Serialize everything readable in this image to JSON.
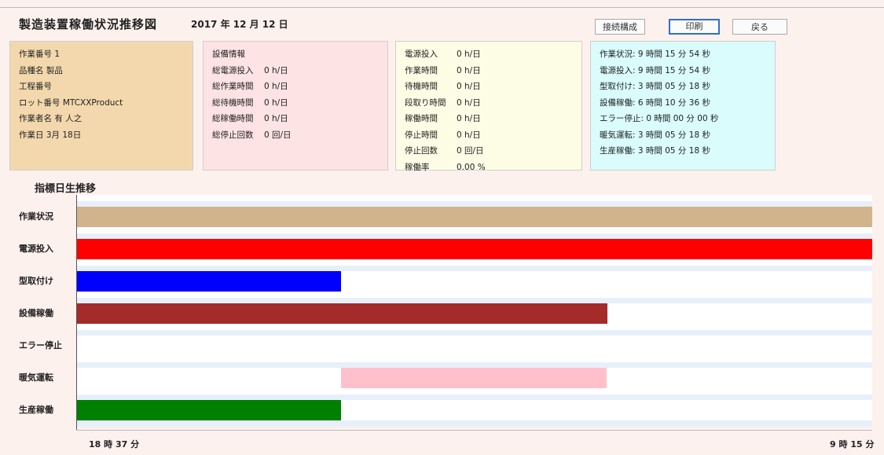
{
  "header": {
    "title": "製造装置稼働状況推移図",
    "date": "2017 年 12 月 12 日"
  },
  "toolbar": {
    "connection_label": "接続構成",
    "print_label": "印刷",
    "back_label": "戻る"
  },
  "work_panel": {
    "rows": [
      "作業番号 1",
      "品種名 製品",
      "工程番号",
      "ロット番号 MTCXXProduct",
      "作業者名 有 人之",
      "作業日 3月 18日"
    ]
  },
  "equipment_panel": {
    "rows": [
      {
        "key": "設備情報",
        "value": ""
      },
      {
        "key": "総電源投入",
        "value": "0 h/日"
      },
      {
        "key": "総作業時間",
        "value": "0 h/日"
      },
      {
        "key": "総待機時間",
        "value": "0 h/日"
      },
      {
        "key": "総稼働時間",
        "value": "0 h/日"
      },
      {
        "key": "総停止回数",
        "value": "0 回/日"
      }
    ]
  },
  "time_panel": {
    "rows": [
      {
        "key": "電源投入",
        "value": "0 h/日"
      },
      {
        "key": "作業時間",
        "value": "0 h/日"
      },
      {
        "key": "待機時間",
        "value": "0 h/日"
      },
      {
        "key": "段取り時間",
        "value": "0 h/日"
      },
      {
        "key": "稼働時間",
        "value": "0 h/日"
      },
      {
        "key": "停止時間",
        "value": "0 h/日"
      },
      {
        "key": "停止回数",
        "value": "0 回/日"
      },
      {
        "key": "稼働率",
        "value": "0.00 %"
      }
    ]
  },
  "status_panel": {
    "rows": [
      "作業状況: 9 時間 15 分 54 秒",
      "電源投入: 9 時間 15 分 54 秒",
      "型取付け: 3 時間 05 分 18 秒",
      "設備稼働: 6 時間 10 分 36 秒",
      "エラー停止: 0 時間 00 分 00 秒",
      "暖気運転: 3 時間 05 分 18 秒",
      "生産稼働: 3 時間 05 分 18 秒"
    ]
  },
  "section_title": "指標日生推移",
  "chart_data": {
    "type": "bar",
    "orientation": "horizontal-timeline",
    "categories": [
      "作業状況",
      "電源投入",
      "型取付け",
      "設備稼働",
      "エラー停止",
      "暖気運転",
      "生産稼働"
    ],
    "x_ticks": [
      "18 時 37 分",
      "9 時 15 分"
    ],
    "series": [
      {
        "category": "作業状況",
        "start": 0,
        "end": 1,
        "color": "#d2b48c"
      },
      {
        "category": "電源投入",
        "start": 0,
        "end": 1,
        "color": "#ff0000"
      },
      {
        "category": "型取付け",
        "start": 0,
        "end": 0.333,
        "color": "#0000ff"
      },
      {
        "category": "設備稼働",
        "start": 0,
        "end": 0.667,
        "color": "#a52a2a"
      },
      {
        "category": "エラー停止",
        "start": 0,
        "end": 0,
        "color": "#888888"
      },
      {
        "category": "暖気運転",
        "start": 0.333,
        "end": 0.667,
        "color": "#ffc0cb"
      },
      {
        "category": "生産稼働",
        "start": 0,
        "end": 0.333,
        "color": "#008000"
      }
    ]
  }
}
